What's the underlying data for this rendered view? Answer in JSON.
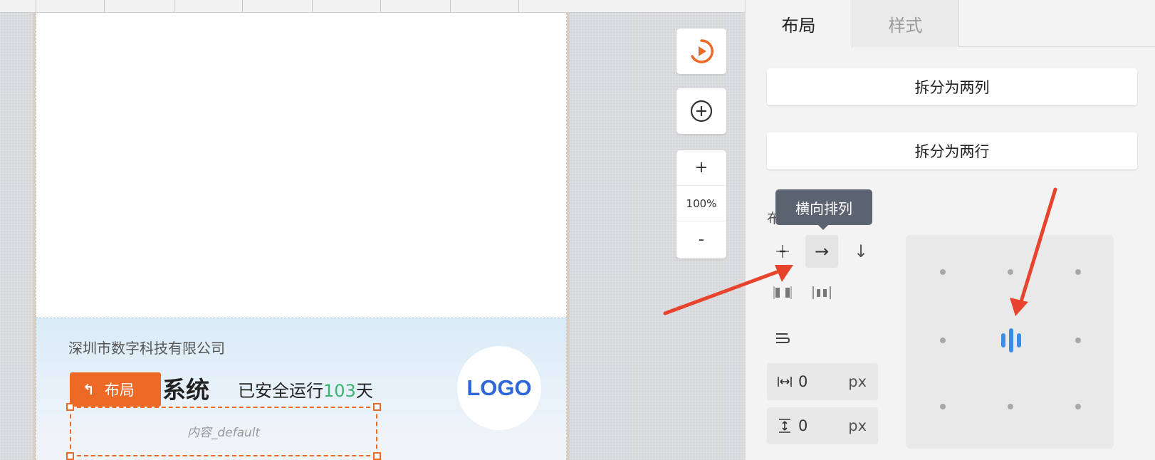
{
  "canvas": {
    "company_name": "深圳市数字科技有限公司",
    "system_title_visible": "系统",
    "run_prefix": "已安全运行",
    "run_days": "103",
    "run_suffix": "天",
    "logo_text": "LOGO",
    "layout_tag_label": "布局",
    "selected_content_label": "内容_default"
  },
  "toolbar": {
    "preview_icon": "play-circle-icon",
    "add_icon": "plus-circle-icon",
    "zoom_in_label": "+",
    "zoom_value": "100%",
    "zoom_out_label": "-"
  },
  "panel": {
    "tabs": [
      {
        "label": "布局",
        "active": true
      },
      {
        "label": "样式",
        "active": false
      }
    ],
    "split_columns_label": "拆分为两列",
    "split_rows_label": "拆分为两行",
    "tooltip_text": "横向排列",
    "direction_label_partial": "布",
    "direction_options": [
      {
        "icon": "free-layout-icon",
        "glyph": "⟊",
        "active": false
      },
      {
        "icon": "horizontal-arrow-icon",
        "glyph": "→",
        "active": true
      },
      {
        "icon": "vertical-arrow-icon",
        "glyph": "↓",
        "active": false
      }
    ],
    "distribution_options": [
      {
        "icon": "space-between-icon"
      },
      {
        "icon": "space-around-icon"
      }
    ],
    "wrap_icon": "wrap-icon",
    "gap_horizontal_value": "0",
    "gap_vertical_value": "0",
    "unit_label": "px",
    "alignment_selected": "center",
    "accent_color": "#ec6a25",
    "highlight_color": "#3a8ee6",
    "annotation_color": "#e8432c"
  }
}
